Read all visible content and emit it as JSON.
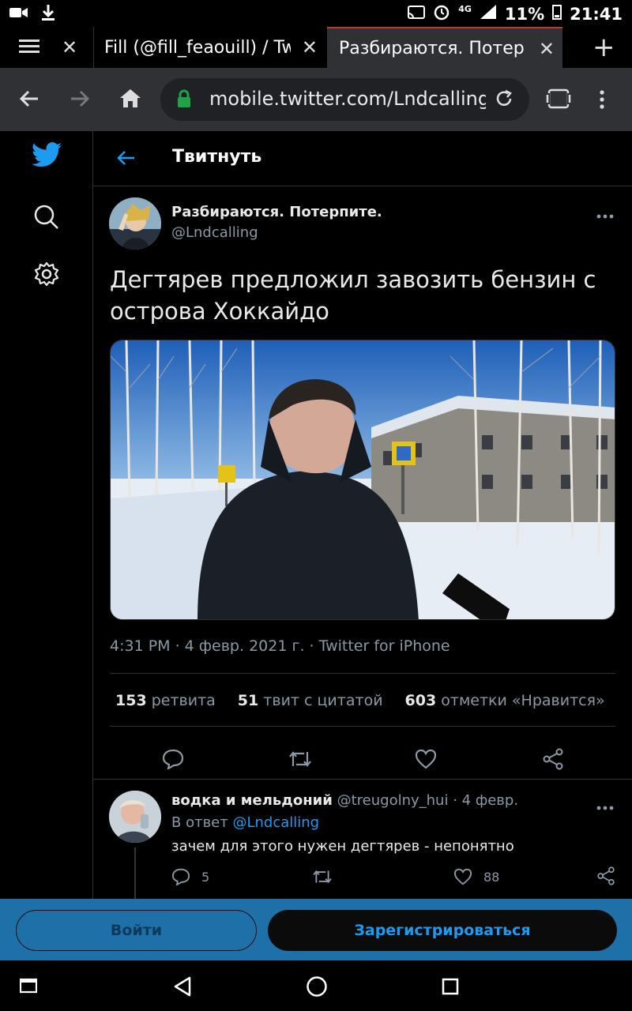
{
  "status": {
    "battery": "11%",
    "time": "21:41",
    "network": "4G"
  },
  "tabs": [
    {
      "title": "Fill (@fill_feaouill) / Tw"
    },
    {
      "title": "Разбираются. Потерпите."
    }
  ],
  "address": {
    "url": "mobile.twitter.com/Lndcalling/s"
  },
  "header": {
    "title": "Твитнуть"
  },
  "tweet": {
    "author": "Разбираются. Потерпите.",
    "handle": "@Lndcalling",
    "text": "Дегтярев предложил завозить бензин с острова Хоккайдо",
    "meta": "4:31 PM · 4 февр. 2021 г. · Twitter for iPhone",
    "retweets_count": "153",
    "retweets_label": "ретвита",
    "quotes_count": "51",
    "quotes_label": "твит с цитатой",
    "likes_count": "603",
    "likes_label": "отметки «Нравится»"
  },
  "reply": {
    "author": "водка и мельдоний",
    "handle": "@treugolny_hui",
    "date": "· 4 февр.",
    "in_reply_prefix": "В ответ",
    "in_reply_handle": "@Lndcalling",
    "text": "зачем для этого нужен дегтярев - непонятно",
    "replies": "5",
    "likes": "88"
  },
  "buttons": {
    "login": "Войти",
    "signup": "Зарегистрироваться"
  },
  "colors": {
    "accent": "#1d9bf0",
    "banner": "#1d70a8"
  }
}
